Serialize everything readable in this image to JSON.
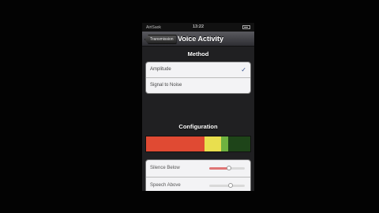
{
  "status_bar": {
    "carrier": "AirtSaok",
    "time": "13:22"
  },
  "nav": {
    "back_label": "Transmission",
    "title": "Voice Activity"
  },
  "method": {
    "header": "Method",
    "options": [
      {
        "label": "Amplitude",
        "selected": true
      },
      {
        "label": "Signal to Noise",
        "selected": false
      }
    ],
    "checkmark": "✓"
  },
  "configuration": {
    "header": "Configuration",
    "meter_segments": [
      {
        "color": "#e04a33",
        "fraction": 0.56
      },
      {
        "color": "#e9df4e",
        "fraction": 0.16
      },
      {
        "color": "#6eb240",
        "fraction": 0.07
      },
      {
        "color": "#1e4419",
        "fraction": 0.21
      }
    ],
    "silence_below": {
      "label": "Silence Below",
      "value": 0.55
    },
    "speech_above": {
      "label": "Speech Above",
      "value": 0.6
    }
  },
  "colors": {
    "accent_check": "#334f8c",
    "slider_fill": "#e07575"
  }
}
